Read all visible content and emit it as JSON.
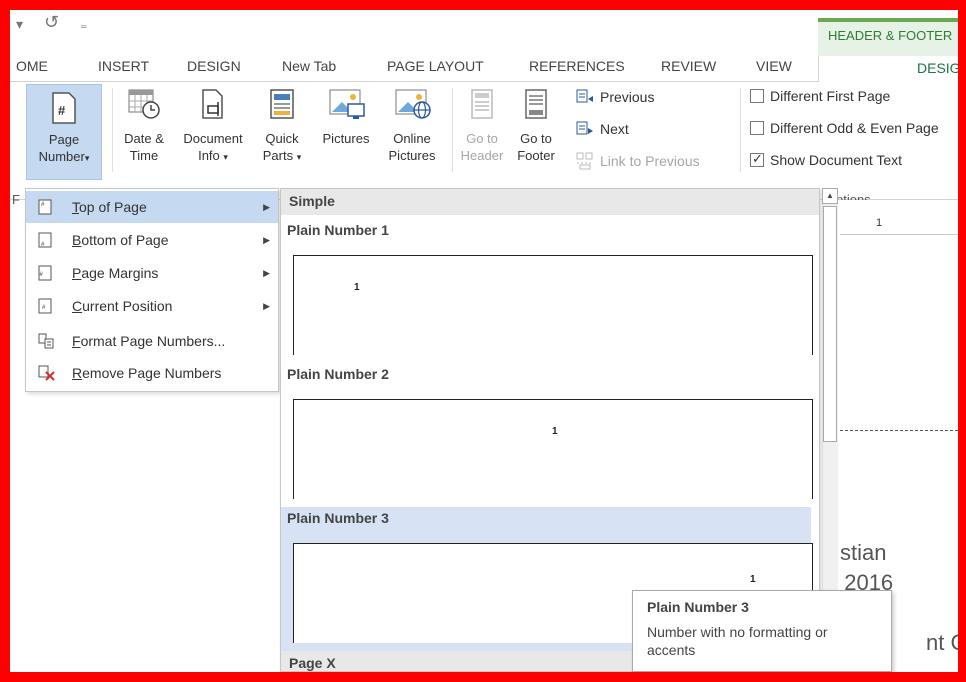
{
  "qat": {
    "undo_icon": "undo-icon",
    "redo_glyph": "↺",
    "customize_glyph": "₌",
    "down_glyph": "▾"
  },
  "context_group": {
    "title": "HEADER & FOOTER"
  },
  "tabs": [
    "OME",
    "INSERT",
    "DESIGN",
    "New Tab",
    "PAGE LAYOUT",
    "REFERENCES",
    "REVIEW",
    "VIEW"
  ],
  "context_tab": "DESIGN",
  "ribbon": {
    "page_number": {
      "line1": "Page",
      "line2": "Number",
      "arrow": "▾"
    },
    "date_time": {
      "line1": "Date &",
      "line2": "Time"
    },
    "document_info": {
      "line1": "Document",
      "line2": "Info",
      "arrow": "▾"
    },
    "quick_parts": {
      "line1": "Quick",
      "line2": "Parts",
      "arrow": "▾"
    },
    "pictures": {
      "line1": "Pictures"
    },
    "online_pictures": {
      "line1": "Online",
      "line2": "Pictures"
    },
    "goto_header": {
      "line1": "Go to",
      "line2": "Header"
    },
    "goto_footer": {
      "line1": "Go to",
      "line2": "Footer"
    },
    "previous": "Previous",
    "next": "Next",
    "link_to_previous": "Link to Previous",
    "options": {
      "different_first_page": "Different First Page",
      "different_odd_even": "Different Odd & Even Page",
      "show_document_text": "Show Document Text",
      "group_label": "ptions"
    }
  },
  "menu": {
    "items": [
      {
        "accel": "T",
        "rest": "op of Page"
      },
      {
        "accel": "B",
        "rest": "ottom of Page"
      },
      {
        "accel": "P",
        "rest": "age Margins"
      },
      {
        "accel": "C",
        "rest": "urrent Position"
      },
      {
        "accel": "F",
        "rest": "ormat Page Numbers..."
      },
      {
        "accel": "R",
        "rest": "emove Page Numbers"
      }
    ],
    "arrow": "▶"
  },
  "gallery": {
    "section_simple": "Simple",
    "items": [
      {
        "title": "Plain Number 1",
        "number": "1"
      },
      {
        "title": "Plain Number 2",
        "number": "1"
      },
      {
        "title": "Plain Number 3",
        "number": "1"
      }
    ],
    "section_page_x": "Page X",
    "scroll_up": "▲"
  },
  "tooltip": {
    "title": "Plain Number 3",
    "description": "Number with no formatting or accents"
  },
  "document": {
    "ruler_label": "1",
    "text1": "stian",
    "text2": ", 2016",
    "text3": "nt C"
  },
  "left_fragment": "F"
}
